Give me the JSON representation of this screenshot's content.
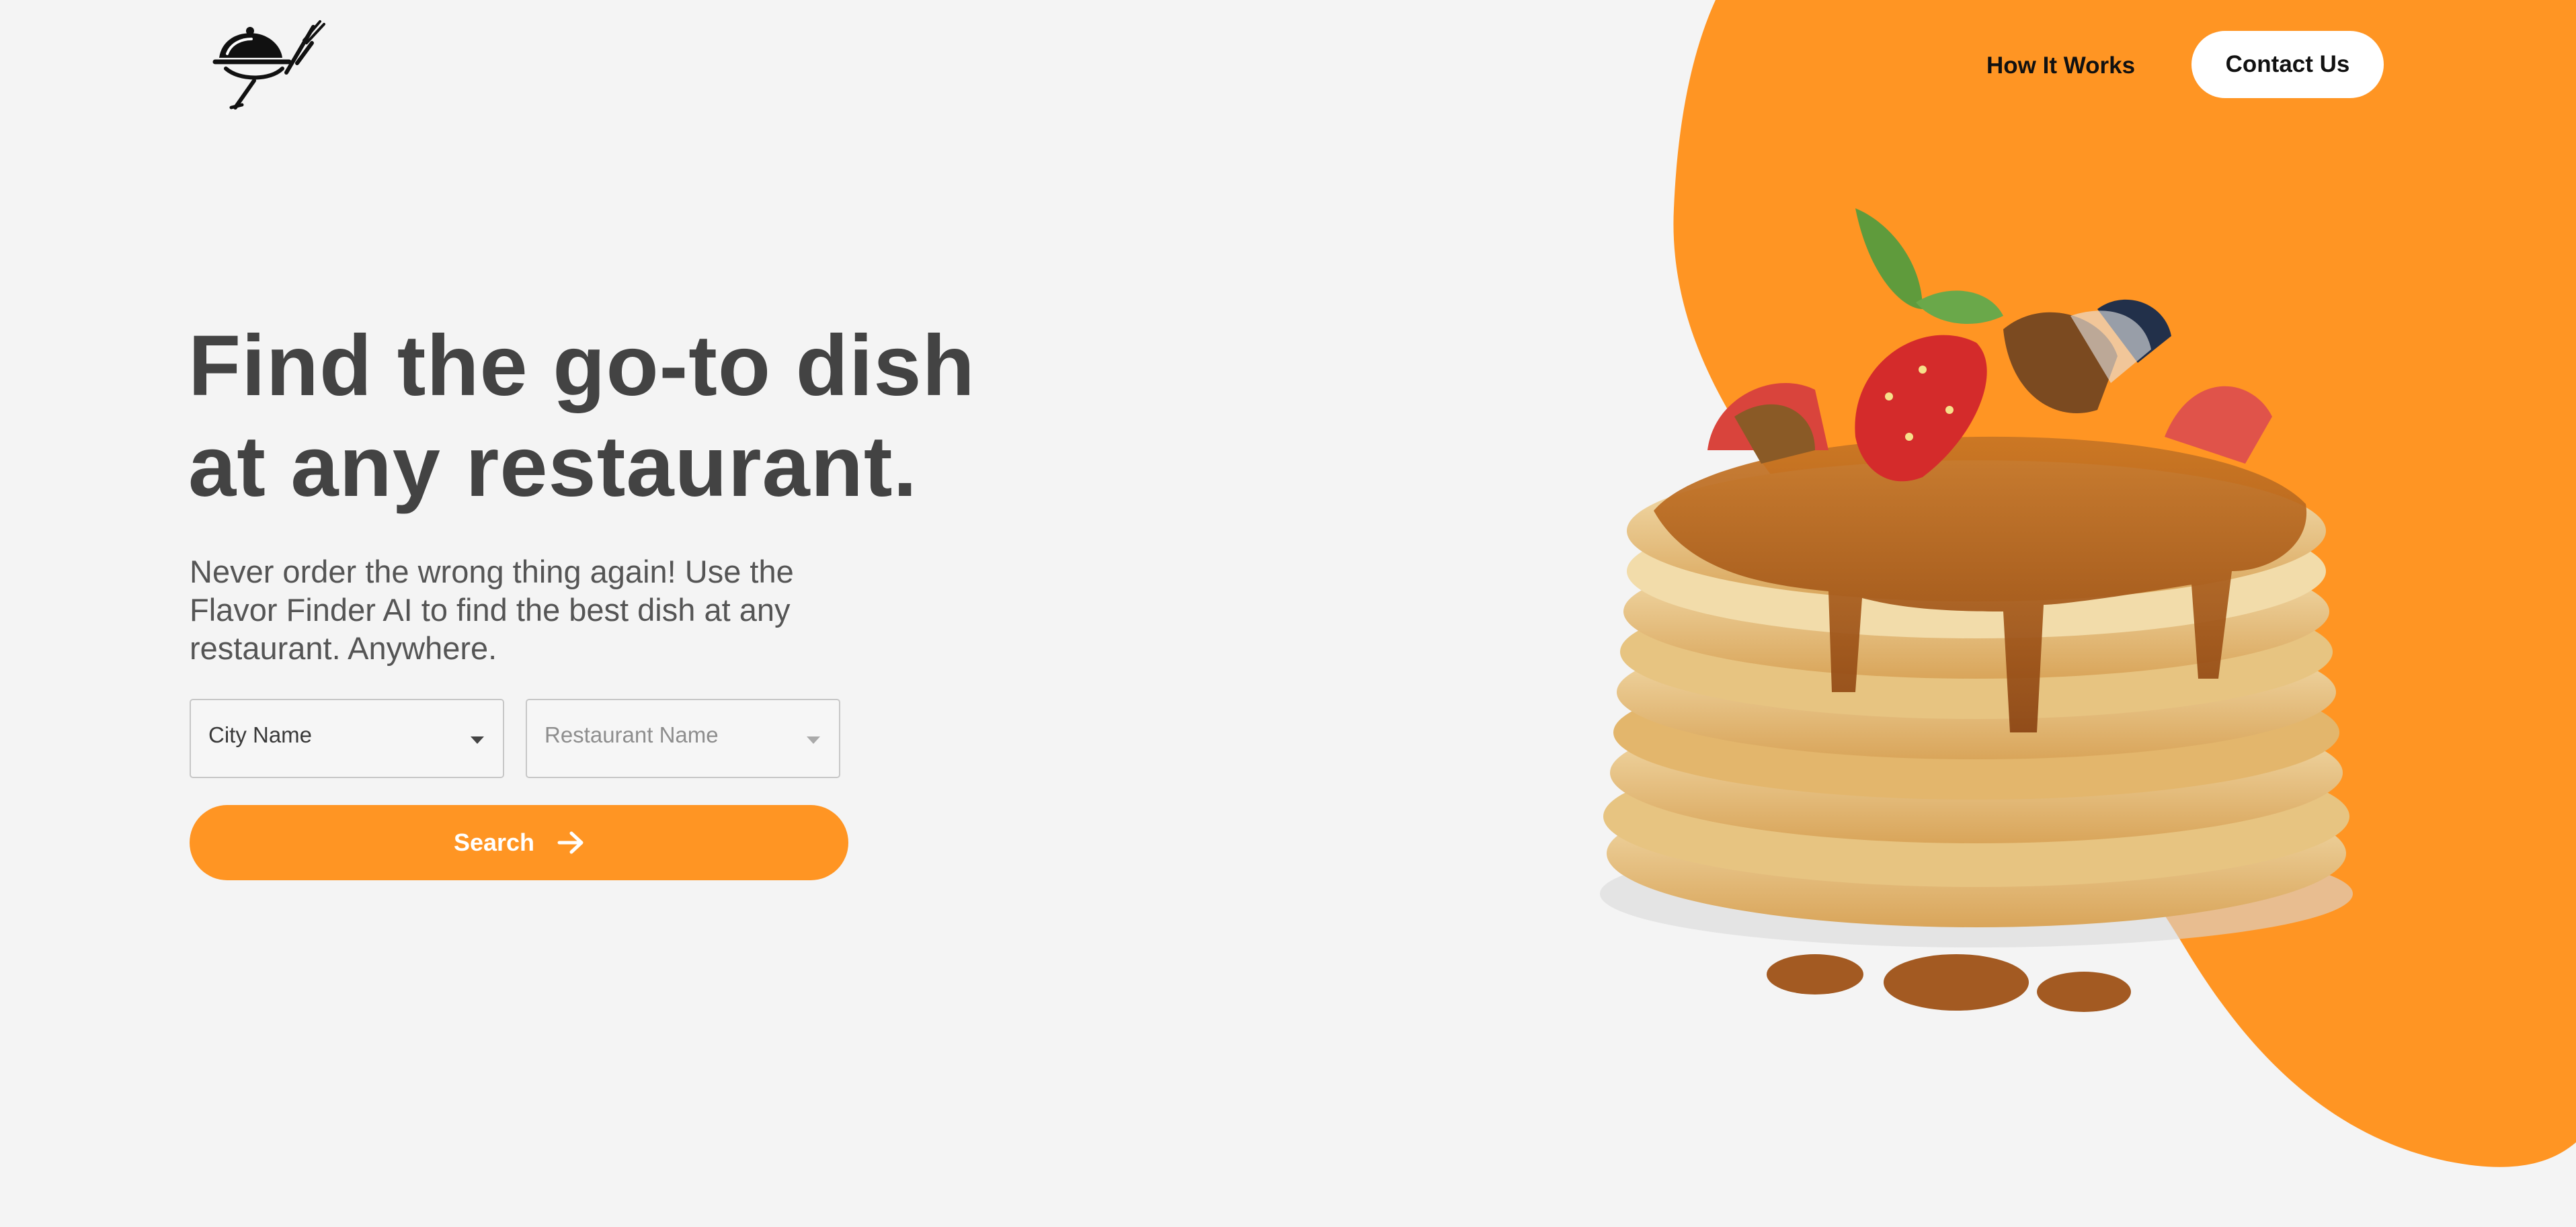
{
  "colors": {
    "accent": "#FF9523",
    "background": "#F4F4F4",
    "title": "#434343",
    "text": "#555555"
  },
  "header": {
    "logo_icon": "serving-cloche-fork-icon",
    "nav": {
      "how_it_works": "How It Works",
      "contact_us": "Contact Us"
    }
  },
  "hero": {
    "title_line1": "Find the go-to dish",
    "title_line2": "at any restaurant.",
    "subtitle": "Never order the wrong thing again! Use the Flavor Finder AI to find the best dish at any restaurant. Anywhere."
  },
  "form": {
    "city_select": {
      "placeholder": "City Name"
    },
    "restaurant_select": {
      "placeholder": "Restaurant Name"
    },
    "search_button": {
      "label": "Search",
      "icon": "arrow-right-icon"
    }
  },
  "hero_image": {
    "subject": "pancakes-icon"
  }
}
